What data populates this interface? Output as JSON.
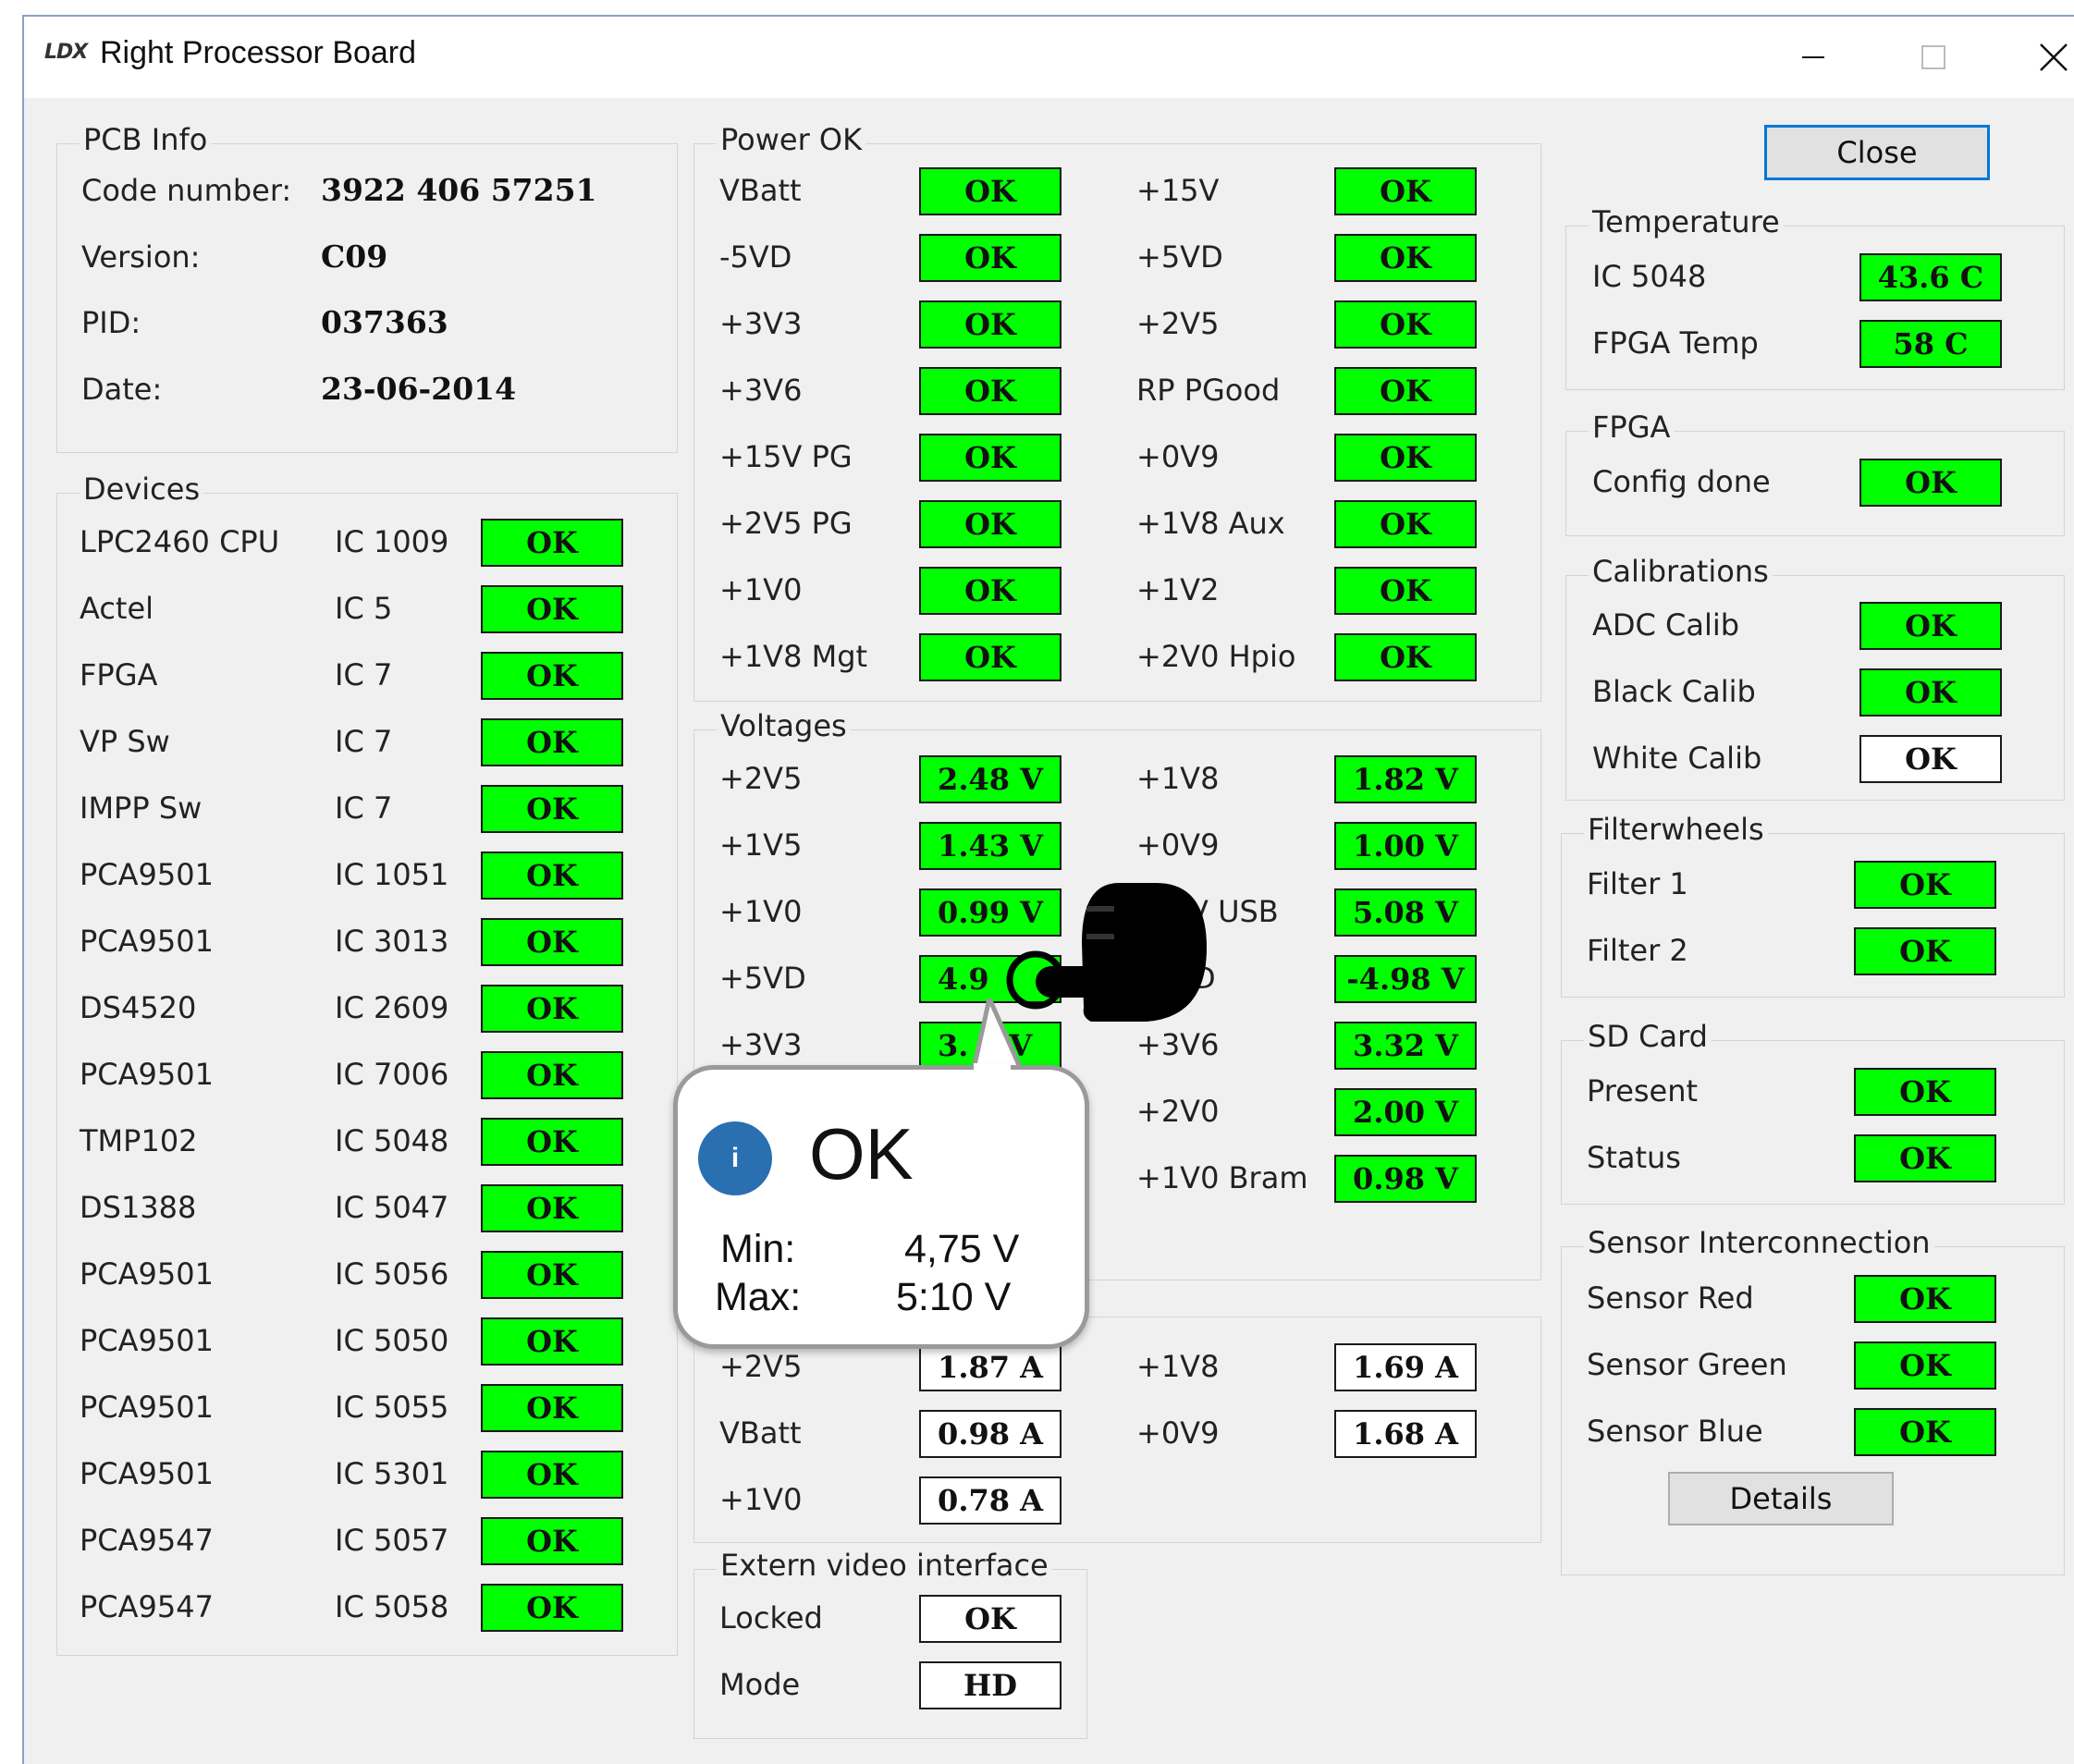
{
  "window": {
    "logo": "LDX",
    "title": "Right Processor Board"
  },
  "pcb_info": {
    "title": "PCB Info",
    "rows": [
      {
        "label": "Code number:",
        "value": "3922 406 57251"
      },
      {
        "label": "Version:",
        "value": "C09"
      },
      {
        "label": "PID:",
        "value": "037363"
      },
      {
        "label": "Date:",
        "value": "23-06-2014"
      }
    ]
  },
  "devices": {
    "title": "Devices",
    "rows": [
      {
        "name": "LPC2460 CPU",
        "ic": "IC 1009",
        "status": "OK"
      },
      {
        "name": "Actel",
        "ic": "IC 5",
        "status": "OK"
      },
      {
        "name": "FPGA",
        "ic": "IC 7",
        "status": "OK"
      },
      {
        "name": "VP Sw",
        "ic": "IC 7",
        "status": "OK"
      },
      {
        "name": "IMPP Sw",
        "ic": "IC 7",
        "status": "OK"
      },
      {
        "name": "PCA9501",
        "ic": "IC 1051",
        "status": "OK"
      },
      {
        "name": "PCA9501",
        "ic": "IC 3013",
        "status": "OK"
      },
      {
        "name": "DS4520",
        "ic": "IC 2609",
        "status": "OK"
      },
      {
        "name": "PCA9501",
        "ic": "IC 7006",
        "status": "OK"
      },
      {
        "name": "TMP102",
        "ic": "IC 5048",
        "status": "OK"
      },
      {
        "name": "DS1388",
        "ic": "IC 5047",
        "status": "OK"
      },
      {
        "name": "PCA9501",
        "ic": "IC 5056",
        "status": "OK"
      },
      {
        "name": "PCA9501",
        "ic": "IC 5050",
        "status": "OK"
      },
      {
        "name": "PCA9501",
        "ic": "IC 5055",
        "status": "OK"
      },
      {
        "name": "PCA9501",
        "ic": "IC 5301",
        "status": "OK"
      },
      {
        "name": "PCA9547",
        "ic": "IC 5057",
        "status": "OK"
      },
      {
        "name": "PCA9547",
        "ic": "IC 5058",
        "status": "OK"
      }
    ]
  },
  "power_ok": {
    "title": "Power OK",
    "left": [
      {
        "label": "VBatt",
        "value": "OK"
      },
      {
        "label": "-5VD",
        "value": "OK"
      },
      {
        "label": "+3V3",
        "value": "OK"
      },
      {
        "label": "+3V6",
        "value": "OK"
      },
      {
        "label": "+15V PG",
        "value": "OK"
      },
      {
        "label": "+2V5 PG",
        "value": "OK"
      },
      {
        "label": "+1V0",
        "value": "OK"
      },
      {
        "label": "+1V8 Mgt",
        "value": "OK"
      }
    ],
    "right": [
      {
        "label": "+15V",
        "value": "OK"
      },
      {
        "label": "+5VD",
        "value": "OK"
      },
      {
        "label": "+2V5",
        "value": "OK"
      },
      {
        "label": "RP PGood",
        "value": "OK"
      },
      {
        "label": "+0V9",
        "value": "OK"
      },
      {
        "label": "+1V8 Aux",
        "value": "OK"
      },
      {
        "label": "+1V2",
        "value": "OK"
      },
      {
        "label": "+2V0 Hpio",
        "value": "OK"
      }
    ]
  },
  "voltages": {
    "title": "Voltages",
    "left": [
      {
        "label": "+2V5",
        "value": "2.48 V"
      },
      {
        "label": "+1V5",
        "value": "1.43 V"
      },
      {
        "label": "+1V0",
        "value": "0.99 V"
      },
      {
        "label": "+5VD",
        "value": "4.9"
      },
      {
        "label": "+3V3",
        "value": "3."
      }
    ],
    "right": [
      {
        "label": "+1V8",
        "value": "1.82 V"
      },
      {
        "label": "+0V9",
        "value": "1.00 V"
      },
      {
        "label": "V USB",
        "value": "5.08 V"
      },
      {
        "label": "D",
        "value": "-4.98 V"
      },
      {
        "label": "+3V6",
        "value": "3.32 V"
      },
      {
        "label": "+2V0",
        "value": "2.00 V"
      },
      {
        "label": "+1V0 Bram",
        "value": "0.98 V"
      }
    ],
    "partial_unit": "V"
  },
  "currents": {
    "left": [
      {
        "label": "+2V5",
        "value": "1.87 A"
      },
      {
        "label": "VBatt",
        "value": "0.98 A"
      },
      {
        "label": "+1V0",
        "value": "0.78 A"
      }
    ],
    "right": [
      {
        "label": "+1V8",
        "value": "1.69 A"
      },
      {
        "label": "+0V9",
        "value": "1.68 A"
      }
    ]
  },
  "extern_video": {
    "title": "Extern video interface",
    "rows": [
      {
        "label": "Locked",
        "value": "OK"
      },
      {
        "label": "Mode",
        "value": "HD"
      }
    ]
  },
  "close_button": "Close",
  "temperature": {
    "title": "Temperature",
    "rows": [
      {
        "label": "IC 5048",
        "value": "43.6 C"
      },
      {
        "label": "FPGA Temp",
        "value": "58 C"
      }
    ]
  },
  "fpga": {
    "title": "FPGA",
    "rows": [
      {
        "label": "Config done",
        "value": "OK"
      }
    ]
  },
  "calibrations": {
    "title": "Calibrations",
    "rows": [
      {
        "label": "ADC Calib",
        "value": "OK",
        "color": "green"
      },
      {
        "label": "Black Calib",
        "value": "OK",
        "color": "green"
      },
      {
        "label": "White Calib",
        "value": "OK",
        "color": "white"
      }
    ]
  },
  "filterwheels": {
    "title": "Filterwheels",
    "rows": [
      {
        "label": "Filter 1",
        "value": "OK"
      },
      {
        "label": "Filter 2",
        "value": "OK"
      }
    ]
  },
  "sd_card": {
    "title": "SD Card",
    "rows": [
      {
        "label": "Present",
        "value": "OK"
      },
      {
        "label": "Status",
        "value": "OK"
      }
    ]
  },
  "sensor_interconnection": {
    "title": "Sensor Interconnection",
    "rows": [
      {
        "label": "Sensor Red",
        "value": "OK"
      },
      {
        "label": "Sensor Green",
        "value": "OK"
      },
      {
        "label": "Sensor Blue",
        "value": "OK"
      }
    ]
  },
  "details_button": "Details",
  "tooltip": {
    "icon": "i",
    "status": "OK",
    "min_label": "Min:",
    "min_value": "4,75 V",
    "max_label": "Max:",
    "max_value": "5:10 V"
  },
  "colors": {
    "ok_green": "#00ff00",
    "window_bg": "#f0f0f0",
    "info_blue": "#2a6fb0"
  },
  "icons": {
    "hand": "hand-pointer-icon",
    "info": "info-icon"
  }
}
